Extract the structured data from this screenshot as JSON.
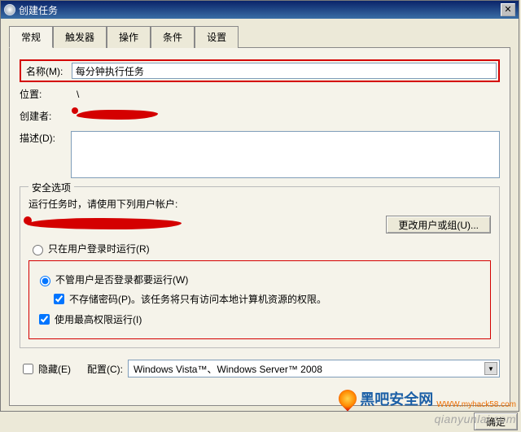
{
  "window": {
    "title": "创建任务",
    "close_glyph": "✕"
  },
  "tabs": {
    "items": [
      {
        "label": "常规",
        "active": true
      },
      {
        "label": "触发器"
      },
      {
        "label": "操作"
      },
      {
        "label": "条件"
      },
      {
        "label": "设置"
      }
    ]
  },
  "general": {
    "name_label": "名称(M):",
    "name_value": "每分钟执行任务",
    "location_label": "位置:",
    "location_value": "\\",
    "creator_label": "创建者:",
    "description_label": "描述(D):",
    "description_value": ""
  },
  "security": {
    "legend": "安全选项",
    "runas_text": "运行任务时，请使用下列用户帐户:",
    "change_user_btn": "更改用户或组(U)...",
    "radio_logged_on": "只在用户登录时运行(R)",
    "radio_always": "不管用户是否登录都要运行(W)",
    "no_password": "不存储密码(P)。该任务将只有访问本地计算机资源的权限。",
    "highest_priv": "使用最高权限运行(I)"
  },
  "bottom": {
    "hidden": "隐藏(E)",
    "config_label": "配置(C):",
    "config_value": "Windows Vista™、Windows Server™ 2008",
    "ok": "确定"
  },
  "watermark": {
    "brand": "黑吧安全网",
    "brand_sub": "WWW.myhack58.com",
    "faint": "qianyunlai.com"
  },
  "states": {
    "radio_always_checked": true,
    "no_password_checked": true,
    "highest_priv_checked": true,
    "hidden_checked": false
  }
}
